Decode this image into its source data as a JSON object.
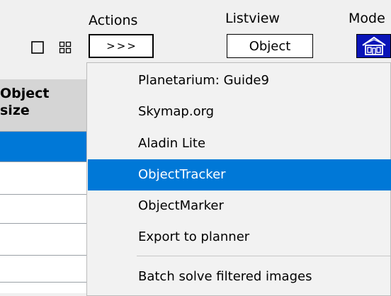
{
  "toolbar": {
    "actions_label": "Actions",
    "actions_button_text": ">>>",
    "listview_label": "Listview",
    "listview_button_text": "Object",
    "mode_label": "Mode",
    "single_view_icon": "square-icon",
    "grid_view_icon": "grid-icon",
    "mode_icon": "house-icon"
  },
  "grid": {
    "header": [
      "Object",
      "size"
    ]
  },
  "menu": {
    "items": [
      "Planetarium: Guide9",
      "Skymap.org",
      "Aladin Lite",
      "ObjectTracker",
      "ObjectMarker",
      "Export to planner",
      "Batch solve filtered images"
    ],
    "highlighted": "ObjectTracker"
  },
  "colors": {
    "selection": "#0078d7",
    "mode_button": "#0a14b8"
  }
}
